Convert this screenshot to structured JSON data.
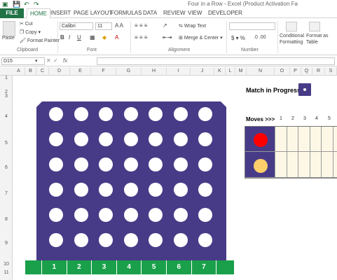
{
  "window": {
    "title": "Four in a Row - Excel (Product Activation Fa"
  },
  "tabs": [
    "FILE",
    "HOME",
    "INSERT",
    "PAGE LAYOUT",
    "FORMULAS",
    "DATA",
    "REVIEW",
    "VIEW",
    "DEVELOPER"
  ],
  "ribbon": {
    "clipboard": {
      "paste": "Paste",
      "cut": "Cut",
      "copy": "Copy",
      "format_painter": "Format Painter",
      "label": "Clipboard"
    },
    "font": {
      "name": "Calibri",
      "size": "11",
      "label": "Font"
    },
    "alignment": {
      "wrap": "Wrap Text",
      "merge": "Merge & Center",
      "label": "Alignment"
    },
    "number": {
      "label": "Number"
    },
    "styles": {
      "conditional_1": "Conditional",
      "conditional_2": "Formatting",
      "format_as_1": "Format as",
      "format_as_2": "Table"
    }
  },
  "formula_bar": {
    "name_box": "D15",
    "fx": "fx",
    "value": ""
  },
  "columns": [
    "A",
    "B",
    "C",
    "D",
    "E",
    "F",
    "G",
    "H",
    "I",
    "J",
    "K",
    "L",
    "M",
    "N",
    "O",
    "P",
    "Q",
    "R",
    "S"
  ],
  "rows": [
    "1",
    "2",
    "3",
    "4",
    "5",
    "6",
    "7",
    "8",
    "9",
    "10",
    "11"
  ],
  "game": {
    "status_text": "Match in Progress!",
    "moves_label": "Moves >>>",
    "move_numbers": [
      "1",
      "2",
      "3",
      "4",
      "5"
    ],
    "column_buttons": [
      "1",
      "2",
      "3",
      "4",
      "5",
      "6",
      "7"
    ],
    "board_rows": 6,
    "board_cols": 7,
    "board_color": "#473b87",
    "player1_color": "#ff0000",
    "player2_color": "#fdd06b"
  }
}
